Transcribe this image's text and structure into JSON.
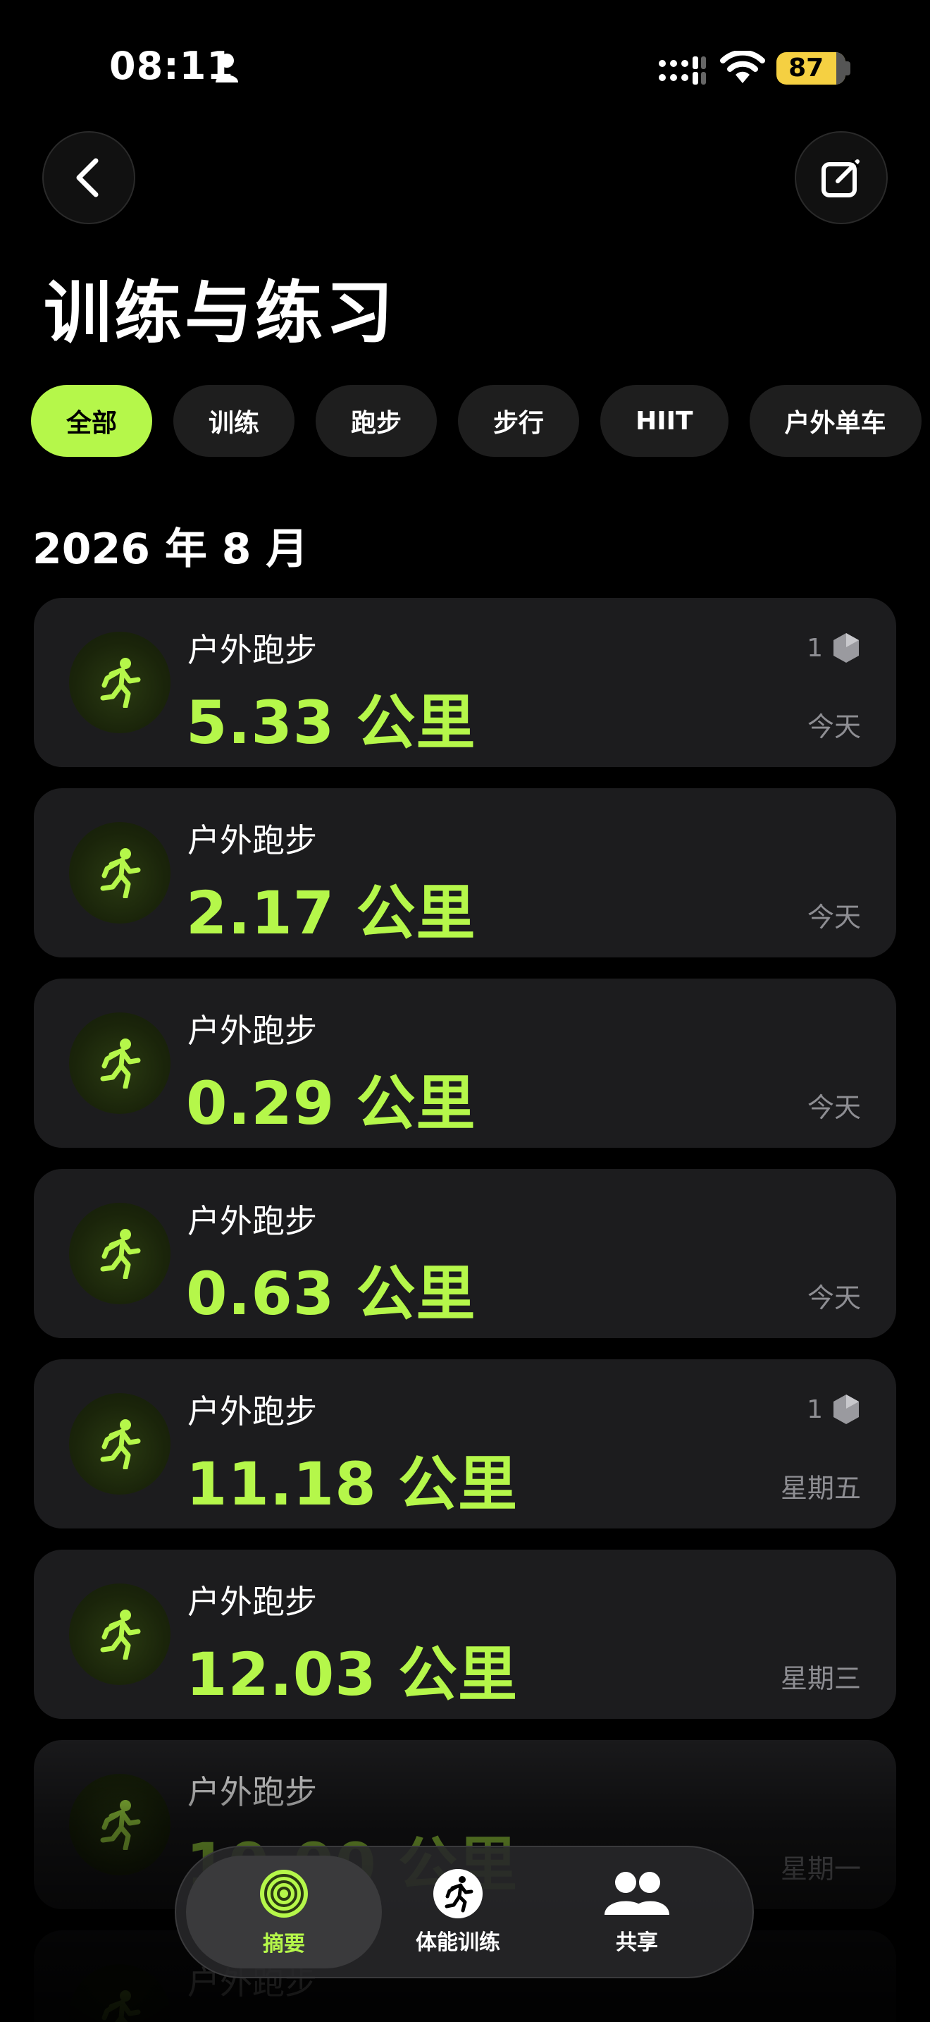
{
  "status_bar": {
    "time": "08:11",
    "battery": "87",
    "battery_level": 0.87
  },
  "header": {
    "title": "训练与练习"
  },
  "filters": [
    "全部",
    "训练",
    "跑步",
    "步行",
    "HIIT",
    "户外单车"
  ],
  "section": {
    "title": "2026 年 8 月"
  },
  "workouts": [
    {
      "title": "户外跑步",
      "value": "5.33 公里",
      "day": "今天",
      "badge": "1"
    },
    {
      "title": "户外跑步",
      "value": "2.17 公里",
      "day": "今天"
    },
    {
      "title": "户外跑步",
      "value": "0.29 公里",
      "day": "今天"
    },
    {
      "title": "户外跑步",
      "value": "0.63 公里",
      "day": "今天"
    },
    {
      "title": "户外跑步",
      "value": "11.18 公里",
      "day": "星期五",
      "badge": "1"
    },
    {
      "title": "户外跑步",
      "value": "12.03 公里",
      "day": "星期三"
    },
    {
      "title": "户外跑步",
      "value": "10.00 公里",
      "day": "星期一"
    },
    {
      "title": "户外跑步",
      "value": "",
      "day": ""
    }
  ],
  "tabs": [
    {
      "label": "摘要",
      "icon": "rings-icon"
    },
    {
      "label": "体能训练",
      "icon": "runner-icon"
    },
    {
      "label": "共享",
      "icon": "people-icon"
    }
  ],
  "colors": {
    "accent": "#b5f74a",
    "card": "#1c1c1e",
    "muted": "#8e8e93",
    "battery": "#f5d042"
  }
}
